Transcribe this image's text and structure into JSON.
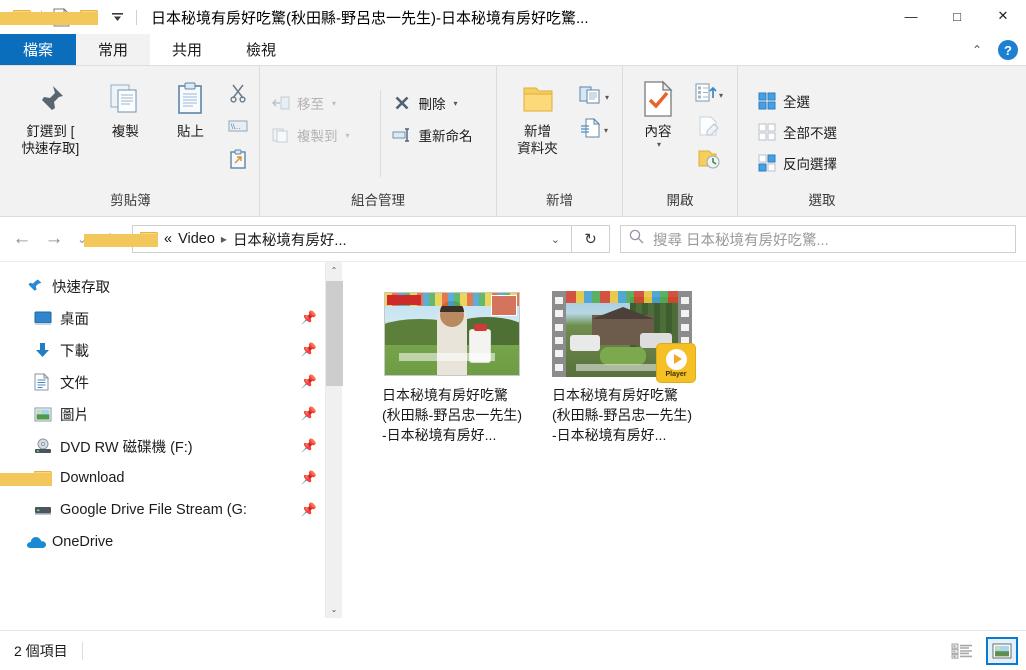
{
  "window": {
    "title": "日本秘境有房好吃驚(秋田縣-野呂忠一先生)-日本秘境有房好吃驚...",
    "minimize_label": "—",
    "maximize_label": "□",
    "close_label": "✕",
    "accent_color": "#0b6ebd"
  },
  "quick_access_toolbar": {
    "items": [
      {
        "name": "explorer-folder-icon",
        "label": ""
      },
      {
        "name": "properties-icon",
        "label": ""
      },
      {
        "name": "new-folder-icon",
        "label": ""
      },
      {
        "name": "customize-dropdown-icon",
        "label": "▾"
      }
    ]
  },
  "ribbon": {
    "tabs": [
      {
        "label": "檔案",
        "name": "tab-file",
        "style": "file"
      },
      {
        "label": "常用",
        "name": "tab-home",
        "style": "active"
      },
      {
        "label": "共用",
        "name": "tab-share",
        "style": ""
      },
      {
        "label": "檢視",
        "name": "tab-view",
        "style": ""
      }
    ],
    "collapse_chevron": "⌃",
    "help_label": "?",
    "groups": [
      {
        "label": "剪貼簿",
        "big_buttons": [
          {
            "label": "釘選到 [\n快速存取]",
            "line1": "釘選到 [",
            "line2": "快速存取]",
            "icon": "pin-icon"
          },
          {
            "label": "複製",
            "icon": "copy-icon"
          },
          {
            "label": "貼上",
            "icon": "paste-icon"
          }
        ],
        "icon_buttons": [
          {
            "name": "cut-icon",
            "label": "剪下"
          },
          {
            "name": "copy-path-icon",
            "label": "複製路徑"
          },
          {
            "name": "paste-shortcut-icon",
            "label": "貼上捷徑"
          }
        ]
      },
      {
        "label": "組合管理",
        "small_buttons": [
          {
            "label": "移至",
            "icon": "move-to-icon",
            "disabled": true,
            "caret": "▾"
          },
          {
            "label": "複製到",
            "icon": "copy-to-icon",
            "disabled": true,
            "caret": "▾"
          },
          {
            "label": "刪除",
            "icon": "delete-icon",
            "disabled": false,
            "caret": "▾"
          },
          {
            "label": "重新命名",
            "icon": "rename-icon",
            "disabled": false,
            "caret": ""
          }
        ]
      },
      {
        "label": "新增",
        "big_buttons": [
          {
            "line1": "新增",
            "line2": "資料夾",
            "icon": "new-folder-icon"
          }
        ],
        "split_buttons": [
          {
            "name": "new-item-icon",
            "label": "新增項目",
            "caret": "▾"
          },
          {
            "name": "easy-access-icon",
            "label": "輕鬆存取",
            "caret": "▾"
          }
        ]
      },
      {
        "label": "開啟",
        "big_buttons": [
          {
            "line1": "內容",
            "line2": "",
            "icon": "properties-icon",
            "caret": "▾"
          }
        ],
        "split_buttons": [
          {
            "name": "open-with-icon",
            "label": "開啟",
            "caret": "▾"
          },
          {
            "name": "edit-icon",
            "label": "編輯",
            "caret": ""
          },
          {
            "name": "history-icon",
            "label": "歷程記錄",
            "caret": ""
          }
        ]
      },
      {
        "label": "選取",
        "select_buttons": [
          {
            "label": "全選",
            "icon": "select-all-icon"
          },
          {
            "label": "全部不選",
            "icon": "select-none-icon"
          },
          {
            "label": "反向選擇",
            "icon": "invert-selection-icon"
          }
        ]
      }
    ]
  },
  "navbar": {
    "back_label": "←",
    "forward_label": "→",
    "recent_label": "⌄",
    "up_label": "↑",
    "breadcrumb": {
      "overflow": "«",
      "items": [
        "Video",
        "日本秘境有房好..."
      ]
    },
    "address_chevron": "⌄",
    "refresh_label": "↻",
    "search_placeholder": "搜尋 日本秘境有房好吃驚...",
    "search_value": ""
  },
  "sidebar": {
    "items": [
      {
        "label": "快速存取",
        "icon": "star-pin-icon",
        "root": true,
        "pinned": false
      },
      {
        "label": "桌面",
        "icon": "desktop-icon",
        "root": false,
        "pinned": true
      },
      {
        "label": "下載",
        "icon": "downloads-icon",
        "root": false,
        "pinned": true
      },
      {
        "label": "文件",
        "icon": "documents-icon",
        "root": false,
        "pinned": true
      },
      {
        "label": "圖片",
        "icon": "pictures-icon",
        "root": false,
        "pinned": true
      },
      {
        "label": "DVD RW 磁碟機 (F:)",
        "icon": "dvd-drive-icon",
        "root": false,
        "pinned": true
      },
      {
        "label": "Download",
        "icon": "folder-icon",
        "root": false,
        "pinned": true
      },
      {
        "label": "Google Drive File Stream (G:",
        "icon": "drive-icon",
        "root": false,
        "pinned": true
      },
      {
        "label": "OneDrive",
        "icon": "onedrive-icon",
        "root": true,
        "pinned": false
      }
    ],
    "scroll_up": "⌃",
    "scroll_down": "⌄"
  },
  "content": {
    "files": [
      {
        "name": "日本秘境有房好吃驚(秋田縣-野呂忠一先生)-日本秘境有房好...",
        "thumb": "video-frame-thumbnail",
        "badge": ""
      },
      {
        "name": "日本秘境有房好吃驚(秋田縣-野呂忠一先生)-日本秘境有房好...",
        "thumb": "film-strip-thumbnail",
        "badge": "Player"
      }
    ]
  },
  "statusbar": {
    "item_count": "2 個項目",
    "views": [
      {
        "name": "details-view-button",
        "label": "詳細資料",
        "active": false
      },
      {
        "name": "large-icons-view-button",
        "label": "大圖示",
        "active": true
      }
    ]
  }
}
